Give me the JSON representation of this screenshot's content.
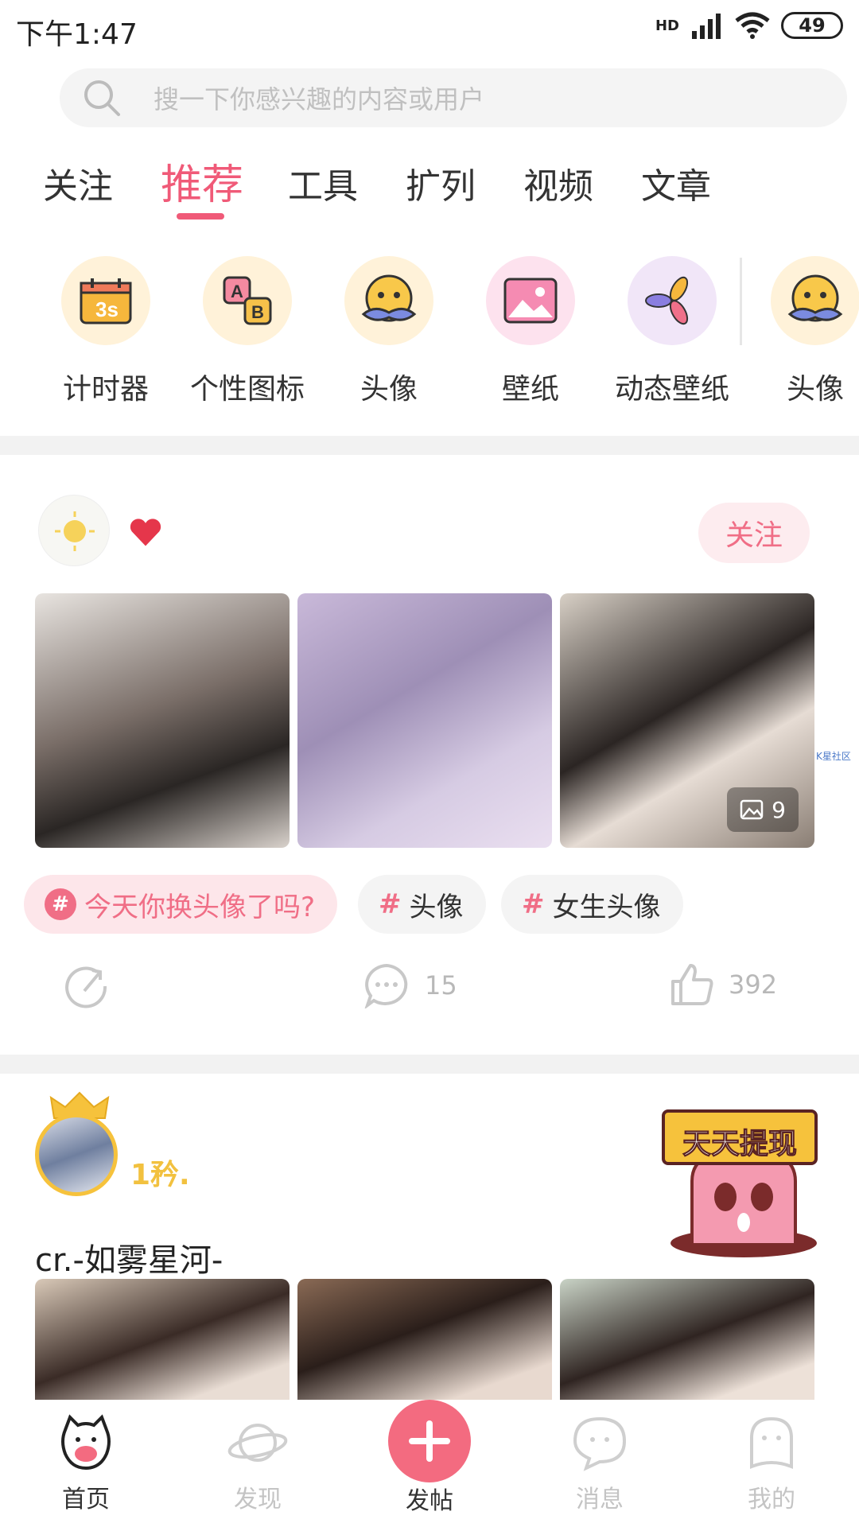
{
  "status_bar": {
    "time": "下午1:47",
    "battery": "49",
    "network": "HD"
  },
  "search": {
    "placeholder": "搜一下你感兴趣的内容或用户"
  },
  "tabs": [
    {
      "label": "关注",
      "active": false
    },
    {
      "label": "推荐",
      "active": true
    },
    {
      "label": "工具",
      "active": false
    },
    {
      "label": "扩列",
      "active": false
    },
    {
      "label": "视频",
      "active": false
    },
    {
      "label": "文章",
      "active": false
    }
  ],
  "tools": [
    {
      "label": "计时器",
      "icon": "timer-icon"
    },
    {
      "label": "个性图标",
      "icon": "ab-icon"
    },
    {
      "label": "头像",
      "icon": "avatar-face-icon"
    },
    {
      "label": "壁纸",
      "icon": "wallpaper-icon"
    },
    {
      "label": "动态壁纸",
      "icon": "live-wallpaper-icon"
    },
    {
      "label": "头像",
      "icon": "avatar-face-icon"
    }
  ],
  "post1": {
    "follow_label": "关注",
    "image_count": "9",
    "watermark": "K星社区",
    "tags": [
      {
        "label": "今天你换头像了吗?",
        "primary": true
      },
      {
        "label": "头像",
        "primary": false
      },
      {
        "label": "女生头像",
        "primary": false
      }
    ],
    "comments": "15",
    "likes": "392"
  },
  "post2": {
    "username": "1矜.",
    "title": "cr.-如雾星河-",
    "promo_label": "天天提现"
  },
  "bottom_nav": [
    {
      "label": "首页",
      "active": true
    },
    {
      "label": "发现",
      "active": false
    },
    {
      "label": "发帖",
      "active": false
    },
    {
      "label": "消息",
      "active": false
    },
    {
      "label": "我的",
      "active": false
    }
  ],
  "colors": {
    "accent": "#f05a78",
    "gold": "#f2c13f"
  }
}
